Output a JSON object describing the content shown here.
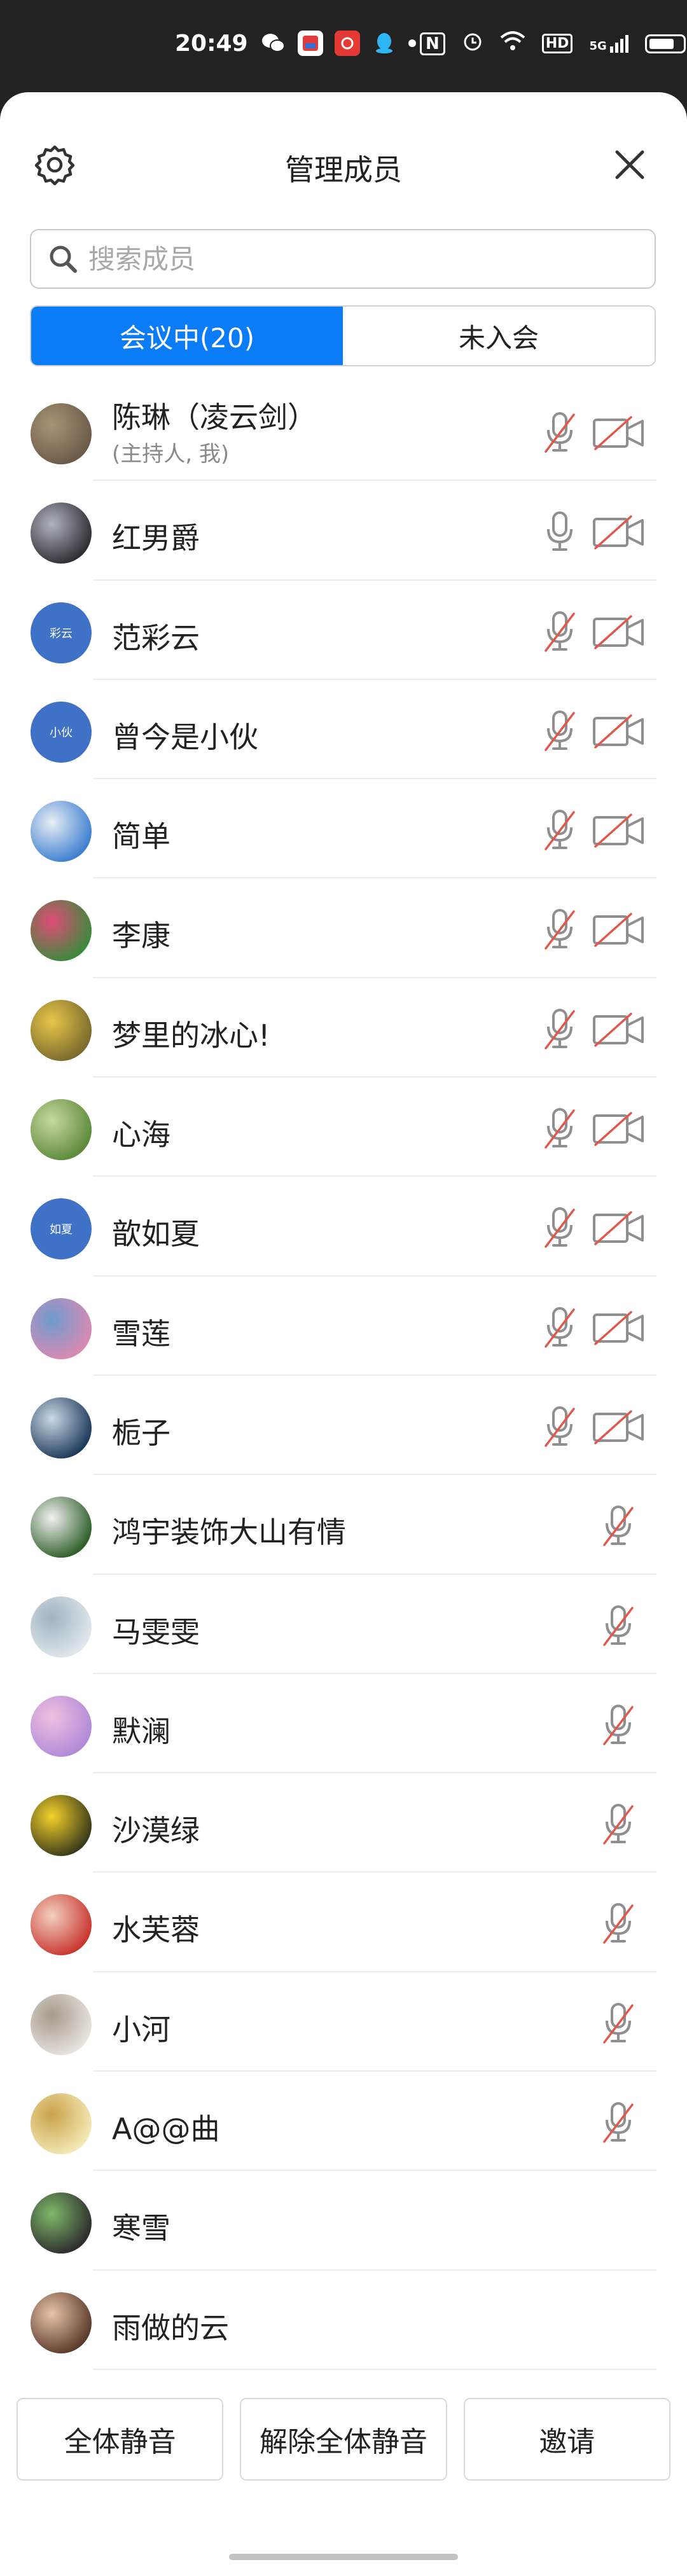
{
  "status_bar": {
    "time": "20:49",
    "network": "5G",
    "hd_label": "HD",
    "nfc_label": "N"
  },
  "header": {
    "title": "管理成员"
  },
  "search": {
    "placeholder": "搜索成员"
  },
  "tabs": [
    {
      "label": "会议中(20)",
      "active": true
    },
    {
      "label": "未入会",
      "active": false
    }
  ],
  "members": [
    {
      "name": "陈琳（凌云剑）",
      "sub": "(主持人, 我)",
      "avatar": "photo",
      "avatar_colors": [
        "#6b5a48",
        "#a89577"
      ],
      "mic": "muted",
      "camera": "off"
    },
    {
      "name": "红男爵",
      "avatar": "photo",
      "avatar_colors": [
        "#2e2e33",
        "#b0b4c0"
      ],
      "mic": "on",
      "camera": "off"
    },
    {
      "name": "范彩云",
      "avatar": "text",
      "avatar_text": "彩云",
      "mic": "muted",
      "camera": "off"
    },
    {
      "name": "曾今是小伙",
      "avatar": "text",
      "avatar_text": "小伙",
      "mic": "muted",
      "camera": "off"
    },
    {
      "name": "简单",
      "avatar": "photo",
      "avatar_colors": [
        "#3d7fd0",
        "#e9eef5"
      ],
      "mic": "muted",
      "camera": "off"
    },
    {
      "name": "李康",
      "avatar": "photo",
      "avatar_colors": [
        "#3b8a3c",
        "#e04c78"
      ],
      "mic": "muted",
      "camera": "off"
    },
    {
      "name": "梦里的冰心!",
      "avatar": "photo",
      "avatar_colors": [
        "#7a6a2d",
        "#e8c64a"
      ],
      "mic": "muted",
      "camera": "off"
    },
    {
      "name": "心海",
      "avatar": "photo",
      "avatar_colors": [
        "#5d8a3a",
        "#c7d9a0"
      ],
      "mic": "muted",
      "camera": "off"
    },
    {
      "name": "歆如夏",
      "avatar": "text",
      "avatar_text": "如夏",
      "mic": "muted",
      "camera": "off"
    },
    {
      "name": "雪莲",
      "avatar": "photo",
      "avatar_colors": [
        "#d98ab0",
        "#6e9bd0"
      ],
      "mic": "muted",
      "camera": "off"
    },
    {
      "name": "栀子",
      "avatar": "photo",
      "avatar_colors": [
        "#1e3a5a",
        "#c9d9e6"
      ],
      "mic": "muted",
      "camera": "off"
    },
    {
      "name": "鸿宇装饰大山有情",
      "avatar": "photo",
      "avatar_colors": [
        "#2f5f2a",
        "#f2f2f2"
      ],
      "mic": "muted",
      "camera": "none"
    },
    {
      "name": "马雯雯",
      "avatar": "photo",
      "avatar_colors": [
        "#dfe7ec",
        "#9fb3c0"
      ],
      "mic": "muted",
      "camera": "none"
    },
    {
      "name": "默澜",
      "avatar": "photo",
      "avatar_colors": [
        "#b08ad8",
        "#f0c0e0"
      ],
      "mic": "muted",
      "camera": "none"
    },
    {
      "name": "沙漠绿",
      "avatar": "photo",
      "avatar_colors": [
        "#3a3a1a",
        "#f4d22a"
      ],
      "mic": "muted",
      "camera": "none"
    },
    {
      "name": "水芙蓉",
      "avatar": "photo",
      "avatar_colors": [
        "#c8362f",
        "#f3d0c0"
      ],
      "mic": "muted",
      "camera": "none"
    },
    {
      "name": "小河",
      "avatar": "photo",
      "avatar_colors": [
        "#e7e3dd",
        "#a69a8c"
      ],
      "mic": "muted",
      "camera": "none"
    },
    {
      "name": "A@@曲",
      "avatar": "photo",
      "avatar_colors": [
        "#f3e9b5",
        "#c9a24a"
      ],
      "mic": "muted",
      "camera": "none"
    },
    {
      "name": "寒雪",
      "avatar": "photo",
      "avatar_colors": [
        "#2d2d2d",
        "#7fb96a"
      ],
      "mic": "none",
      "camera": "none"
    },
    {
      "name": "雨做的云",
      "avatar": "photo",
      "avatar_colors": [
        "#5a3a2a",
        "#e8c3a8"
      ],
      "mic": "none",
      "camera": "none"
    }
  ],
  "footer": {
    "mute_all": "全体静音",
    "unmute_all": "解除全体静音",
    "invite": "邀请"
  },
  "colors": {
    "accent": "#0a7cf8",
    "muted_slash": "#e0584c",
    "icon_gray": "#8f8f8f"
  }
}
